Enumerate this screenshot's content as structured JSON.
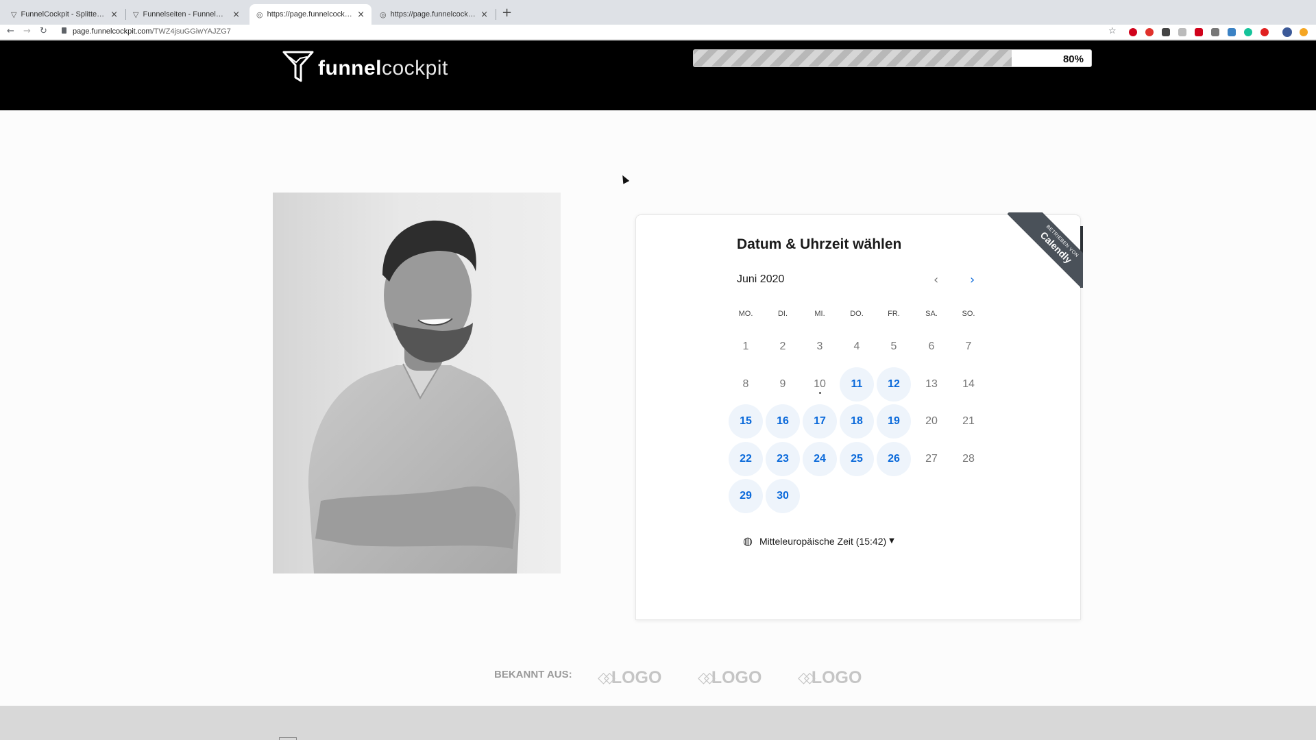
{
  "browser": {
    "tabs": [
      {
        "label": "FunnelCockpit - Splittests, Ma",
        "active": false
      },
      {
        "label": "Funnelseiten - FunnelCockpit",
        "active": false
      },
      {
        "label": "https://page.funnelcockpit.co",
        "active": true
      },
      {
        "label": "https://page.funnelcockpit.co",
        "active": false
      }
    ],
    "url_host": "page.funnelcockpit.com",
    "url_path": "/TWZ4jsuGGiwYAJZG7",
    "icons": {
      "back": "back-arrow-icon",
      "forward": "forward-arrow-icon",
      "reload": "reload-icon",
      "lock": "lock-icon",
      "star": "bookmark-star-icon",
      "new_tab": "plus-icon",
      "tab_close": "close-icon"
    }
  },
  "header": {
    "logo_bold": "funnel",
    "logo_thin": "cockpit",
    "progress_label": "80%",
    "progress_value": 0.8,
    "background": "#000000"
  },
  "calendar": {
    "badge_small": "BETRIEBEN VON",
    "badge_big": "Calendly",
    "title": "Datum & Uhrzeit wählen",
    "month": "Juni 2020",
    "weekdays": [
      "MO.",
      "DI.",
      "MI.",
      "DO.",
      "FR.",
      "SA.",
      "SO."
    ],
    "weeks": [
      [
        {
          "d": "1",
          "a": false
        },
        {
          "d": "2",
          "a": false
        },
        {
          "d": "3",
          "a": false
        },
        {
          "d": "4",
          "a": false
        },
        {
          "d": "5",
          "a": false
        },
        {
          "d": "6",
          "a": false
        },
        {
          "d": "7",
          "a": false
        }
      ],
      [
        {
          "d": "8",
          "a": false
        },
        {
          "d": "9",
          "a": false
        },
        {
          "d": "10",
          "a": false,
          "today": true
        },
        {
          "d": "11",
          "a": true
        },
        {
          "d": "12",
          "a": true
        },
        {
          "d": "13",
          "a": false
        },
        {
          "d": "14",
          "a": false
        }
      ],
      [
        {
          "d": "15",
          "a": true
        },
        {
          "d": "16",
          "a": true
        },
        {
          "d": "17",
          "a": true
        },
        {
          "d": "18",
          "a": true
        },
        {
          "d": "19",
          "a": true
        },
        {
          "d": "20",
          "a": false
        },
        {
          "d": "21",
          "a": false
        }
      ],
      [
        {
          "d": "22",
          "a": true
        },
        {
          "d": "23",
          "a": true
        },
        {
          "d": "24",
          "a": true
        },
        {
          "d": "25",
          "a": true
        },
        {
          "d": "26",
          "a": true
        },
        {
          "d": "27",
          "a": false
        },
        {
          "d": "28",
          "a": false
        }
      ],
      [
        {
          "d": "29",
          "a": true
        },
        {
          "d": "30",
          "a": true
        }
      ]
    ],
    "timezone": "Mitteleuropäische Zeit (15:42)",
    "accent_color": "#0a69da",
    "available_bg": "#eef4fb",
    "icons": {
      "prev": "chevron-left-icon",
      "next": "chevron-right-icon",
      "timezone": "globe-icon",
      "dropdown": "caret-down-icon"
    }
  },
  "known_from": {
    "label": "BEKANNT AUS:",
    "logos": [
      "LOGO",
      "LOGO",
      "LOGO"
    ]
  }
}
